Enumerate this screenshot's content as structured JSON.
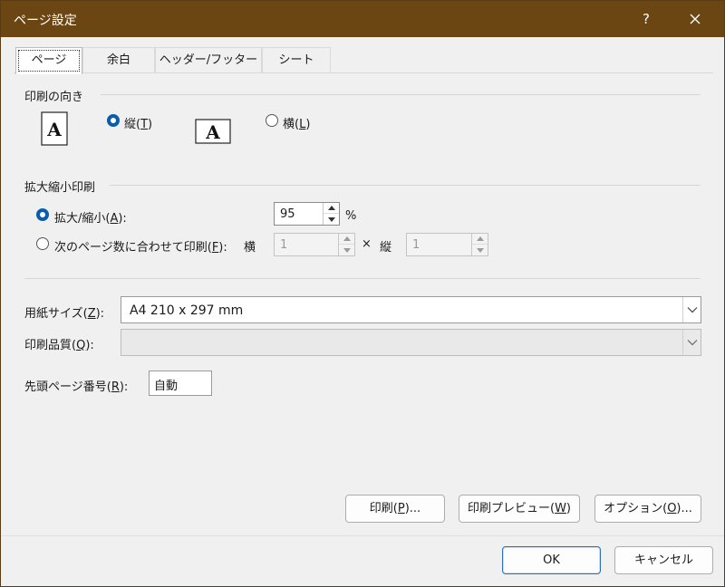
{
  "title": "ページ設定",
  "title_help": "?",
  "tabs": [
    {
      "label": "ページ",
      "active": true
    },
    {
      "label": "余白",
      "active": false
    },
    {
      "label": "ヘッダー/フッター",
      "active": false
    },
    {
      "label": "シート",
      "active": false
    }
  ],
  "orientation": {
    "label": "印刷の向き",
    "portrait": {
      "label_pre": "縦(",
      "key": "T",
      "label_post": ")",
      "checked": true
    },
    "landscape": {
      "label_pre": "横(",
      "key": "L",
      "label_post": ")",
      "checked": false
    },
    "icon_letter": "A"
  },
  "scaling": {
    "label": "拡大縮小印刷",
    "adjust": {
      "label_pre": "拡大/縮小(",
      "key": "A",
      "label_post": "):",
      "value": "95",
      "unit": "%",
      "checked": true
    },
    "fit": {
      "label_pre": "次のページ数に合わせて印刷(",
      "key": "F",
      "label_post": "):",
      "wide_label": "横",
      "wide_value": "1",
      "times": "×",
      "tall_label": "縦",
      "tall_value": "1",
      "checked": false
    }
  },
  "paper_size": {
    "label_pre": "用紙サイズ(",
    "key": "Z",
    "label_post": "):",
    "value": "A4 210 x 297 mm"
  },
  "print_quality": {
    "label_pre": "印刷品質(",
    "key": "Q",
    "label_post": "):",
    "value": ""
  },
  "first_page": {
    "label_pre": "先頭ページ番号(",
    "key": "R",
    "label_post": "):",
    "value": "自動"
  },
  "buttons": {
    "print": {
      "pre": "印刷(",
      "key": "P",
      "post": ")..."
    },
    "preview": {
      "pre": "印刷プレビュー(",
      "key": "W",
      "post": ")"
    },
    "options": {
      "pre": "オプション(",
      "key": "O",
      "post": ")..."
    },
    "ok": "OK",
    "cancel": "キャンセル"
  }
}
